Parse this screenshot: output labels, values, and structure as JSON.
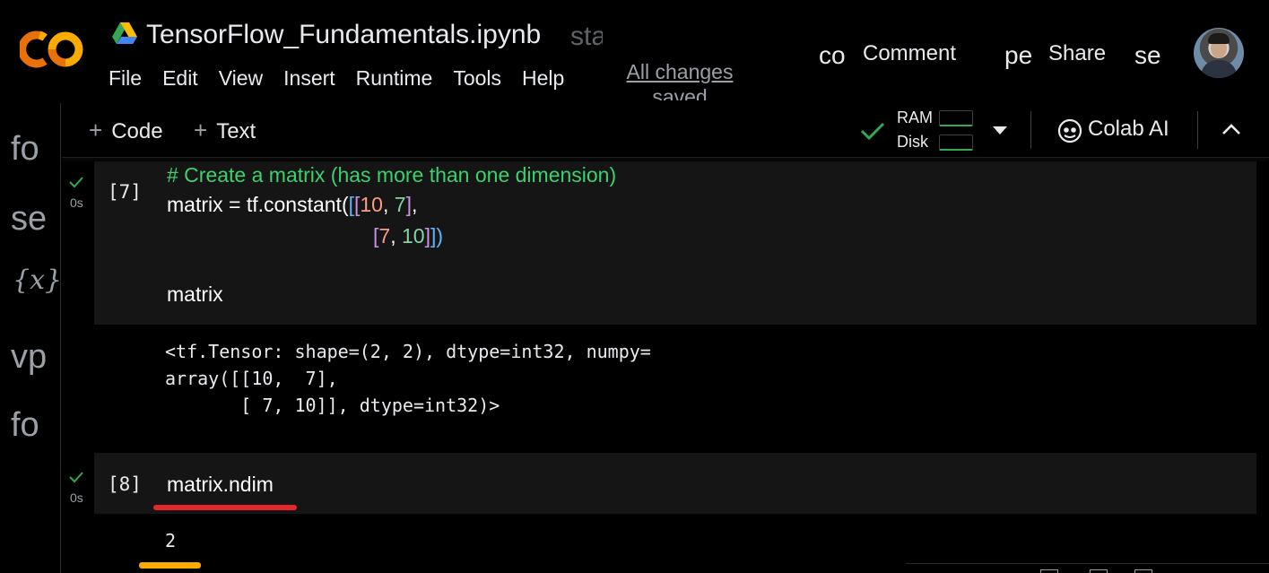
{
  "header": {
    "notebook_title": "TensorFlow_Fundamentals.ipynb",
    "title_extra": "sta",
    "menu": [
      "File",
      "Edit",
      "View",
      "Insert",
      "Runtime",
      "Tools",
      "Help"
    ],
    "save_status": "All changes saved",
    "comment_icon_text": "co",
    "comment_label": "Comment",
    "share_icon_text": "pe",
    "share_label": "Share",
    "settings_icon_text": "se"
  },
  "rail": {
    "items": [
      "fo",
      "se",
      "{x}",
      "vp",
      "fo"
    ]
  },
  "toolbar": {
    "add_code": "Code",
    "add_text": "Text",
    "plus": "+",
    "ram_label": "RAM",
    "disk_label": "Disk",
    "colab_ai_label": "Colab AI"
  },
  "cells": [
    {
      "exec_count": "[7]",
      "time": "0s",
      "code_comment": "# Create a matrix (has more than one dimension)",
      "code_line2_prefix": "matrix = tf.constant(",
      "code_line2_b1": "(",
      "code_line2_b2": "[",
      "code_line2_b3": "[",
      "code_line2_n1": "10",
      "code_line2_sep": ", ",
      "code_line2_n2": "7",
      "code_line2_close": "]",
      "code_line2_comma": ",",
      "code_line3_open": "[",
      "code_line3_n1": "7",
      "code_line3_sep": ", ",
      "code_line3_n2": "10",
      "code_line3_close1": "]",
      "code_line3_close2": "]",
      "code_line3_close3": ")",
      "code_line5": "matrix",
      "output": "<tf.Tensor: shape=(2, 2), dtype=int32, numpy=\narray([[10,  7],\n       [ 7, 10]], dtype=int32)>"
    },
    {
      "exec_count": "[8]",
      "time": "0s",
      "code": "matrix.ndim",
      "output": "2"
    }
  ],
  "colors": {
    "background": "#000000",
    "cell_background": "#151515",
    "comment_green": "#3bd16f",
    "annotation_red": "#e3262b",
    "annotation_yellow": "#f9ab00",
    "colab_orange": "#f9ab00"
  }
}
